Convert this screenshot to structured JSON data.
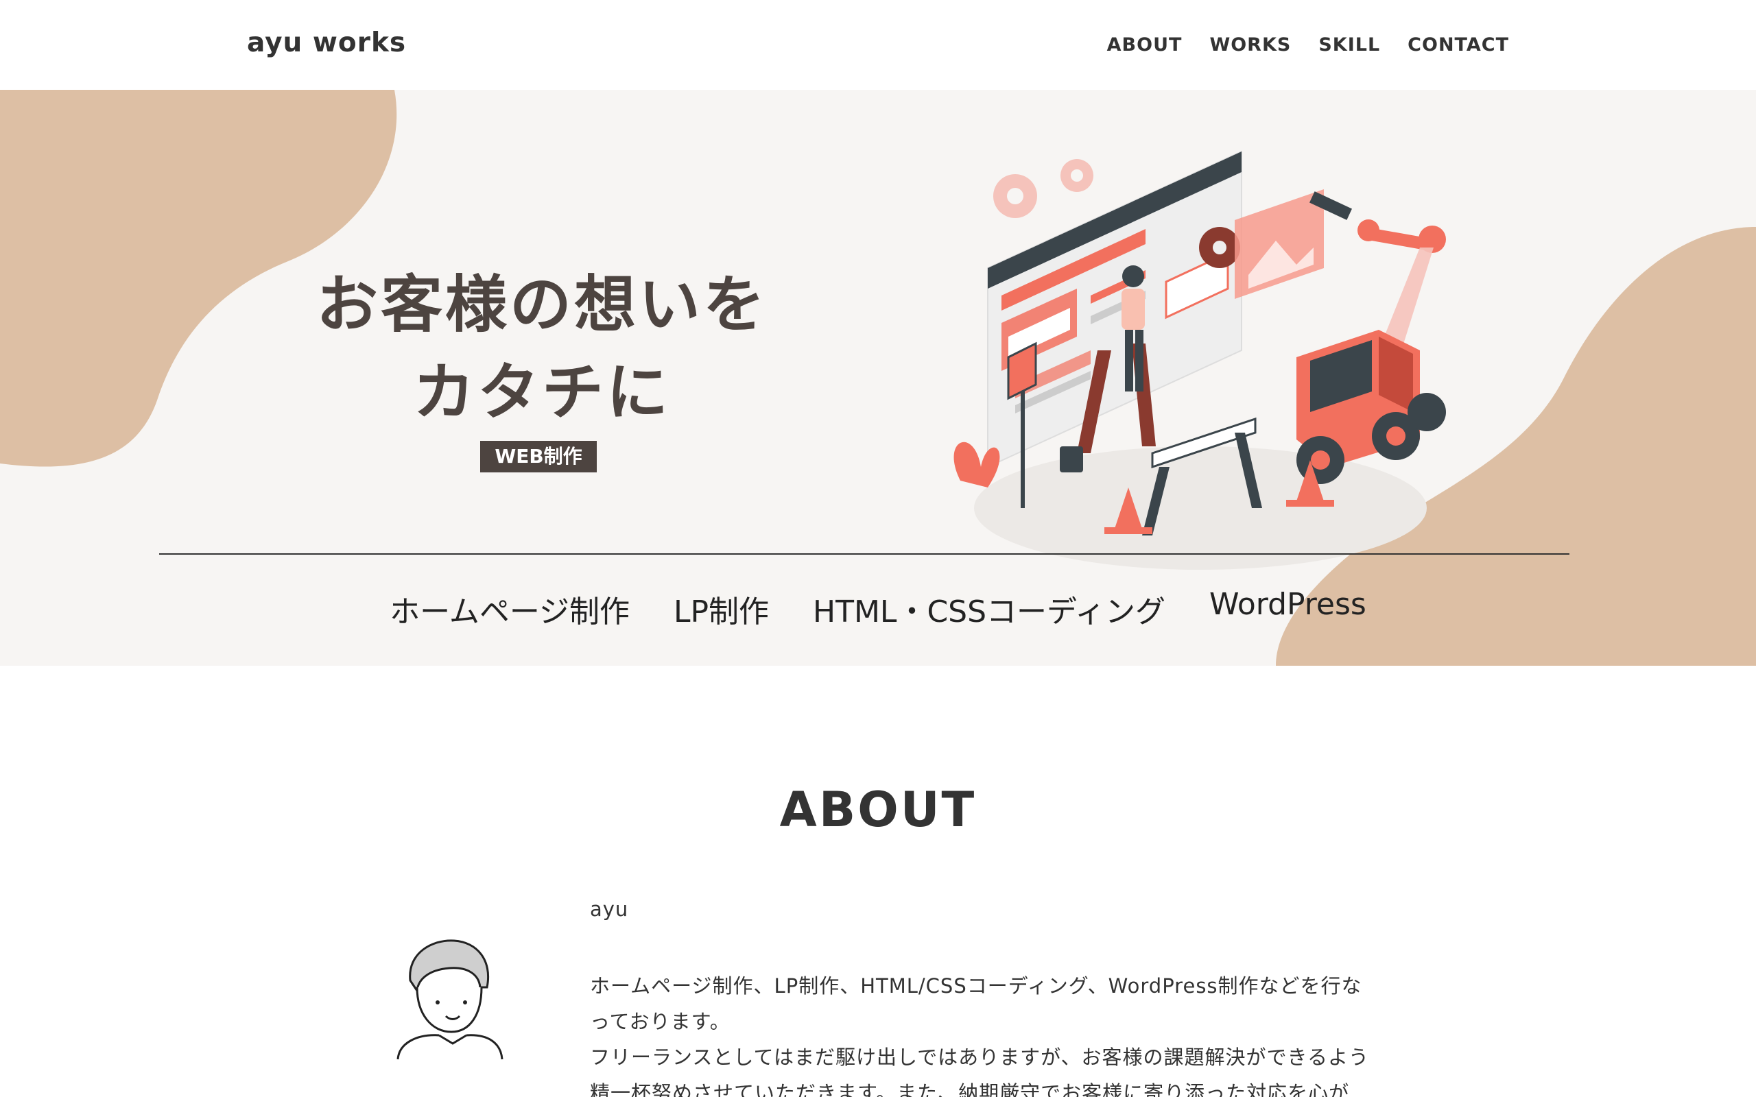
{
  "header": {
    "logo": "ayu works",
    "nav": [
      {
        "label": "ABOUT"
      },
      {
        "label": "WORKS"
      },
      {
        "label": "SKILL"
      },
      {
        "label": "CONTACT"
      }
    ]
  },
  "hero": {
    "title_line1": "お客様の想いを",
    "title_line2": "カタチに",
    "badge": "WEB制作",
    "services": [
      "ホームページ制作",
      "LP制作",
      "HTML・CSSコーディング",
      "WordPress"
    ],
    "colors": {
      "background": "#f7f5f3",
      "blob": "#ddbfa4",
      "accent": "#f2705e",
      "dark": "#4d4440"
    }
  },
  "about": {
    "heading": "ABOUT",
    "name": "ayu",
    "body_line1": "ホームページ制作、LP制作、HTML/CSSコーディング、WordPress制作などを行な",
    "body_line2": "っております。",
    "body_line3": "フリーランスとしてはまだ駆け出しではありますが、お客様の課題解決ができるよう",
    "body_line4": "精一杯努めさせていただきます。また、納期厳守でお客様に寄り添った対応を心が"
  }
}
